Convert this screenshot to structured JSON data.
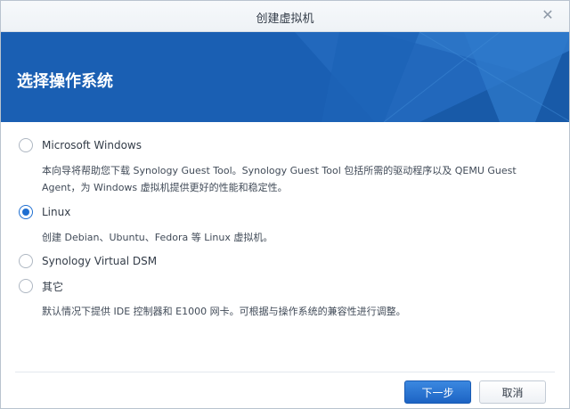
{
  "window": {
    "title": "创建虚拟机",
    "close_glyph": "✕"
  },
  "banner": {
    "heading": "选择操作系统",
    "color": "#1a5fb3"
  },
  "options": [
    {
      "label": "Microsoft Windows",
      "checked": false,
      "description": "本向导将帮助您下载 Synology Guest Tool。Synology Guest Tool 包括所需的驱动程序以及 QEMU Guest Agent，为 Windows 虚拟机提供更好的性能和稳定性。"
    },
    {
      "label": "Linux",
      "checked": true,
      "description": "创建 Debian、Ubuntu、Fedora 等 Linux 虚拟机。"
    },
    {
      "label": "Synology Virtual DSM",
      "checked": false,
      "description": ""
    },
    {
      "label": "其它",
      "checked": false,
      "description": "默认情况下提供 IDE 控制器和 E1000 网卡。可根据与操作系统的兼容性进行调整。"
    }
  ],
  "footer": {
    "next_label": "下一步",
    "cancel_label": "取消"
  },
  "colors": {
    "accent": "#1f6fd1",
    "text": "#333c48"
  }
}
